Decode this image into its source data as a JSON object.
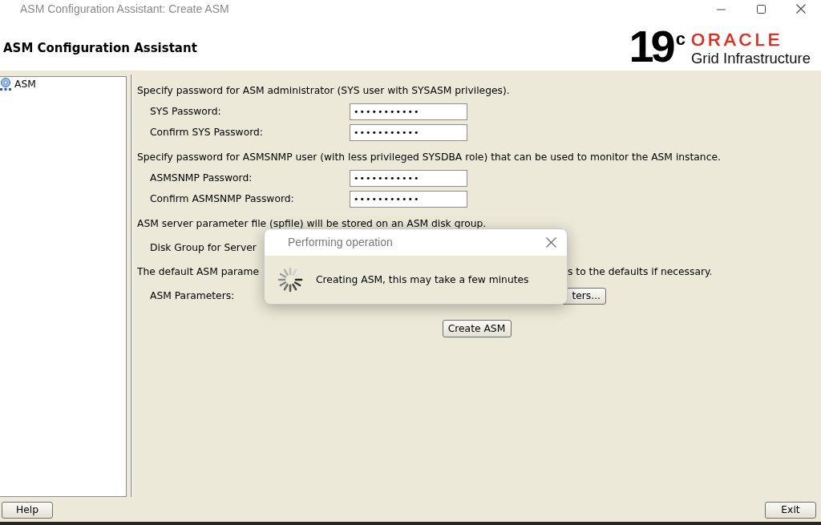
{
  "window": {
    "title": "ASM Configuration Assistant: Create ASM"
  },
  "header": {
    "title": "ASM Configuration Assistant",
    "logo": {
      "version": "19",
      "version_suffix": "c",
      "brand": "ORACLE",
      "product": "Grid Infrastructure"
    }
  },
  "tree": {
    "items": [
      {
        "label": "ASM",
        "selected": false
      }
    ]
  },
  "form": {
    "rows": [
      {
        "kind": "note",
        "text": "Specify password for ASM administrator (SYS user with SYSASM privileges)."
      },
      {
        "kind": "password",
        "label": "SYS Password:",
        "value": "•••••••••••"
      },
      {
        "kind": "password",
        "label": "Confirm SYS Password:",
        "value": "•••••••••••"
      },
      {
        "kind": "note",
        "text": "Specify password for ASMSNMP user (with less privileged SYSDBA role) that can be used to monitor the ASM instance."
      },
      {
        "kind": "password",
        "label": "ASMSNMP Password:",
        "value": "•••••••••••"
      },
      {
        "kind": "password",
        "label": "Confirm ASMSNMP Password:",
        "value": "•••••••••••"
      },
      {
        "kind": "note",
        "text": "ASM server parameter file (spfile) will be stored on an ASM disk group."
      },
      {
        "kind": "label",
        "label": "Disk Group for Server"
      },
      {
        "kind": "split_note",
        "left": "The default ASM parame",
        "right": "s to the defaults if necessary."
      },
      {
        "kind": "button_row",
        "label": "ASM Parameters:",
        "button": "ters..."
      },
      {
        "kind": "action",
        "button": "Create ASM"
      }
    ]
  },
  "dialog": {
    "title": "Performing operation",
    "message": "Creating ASM, this may take a few minutes"
  },
  "footer": {
    "buttons": [
      {
        "label": "Help"
      },
      {
        "label": "Exit"
      }
    ]
  }
}
